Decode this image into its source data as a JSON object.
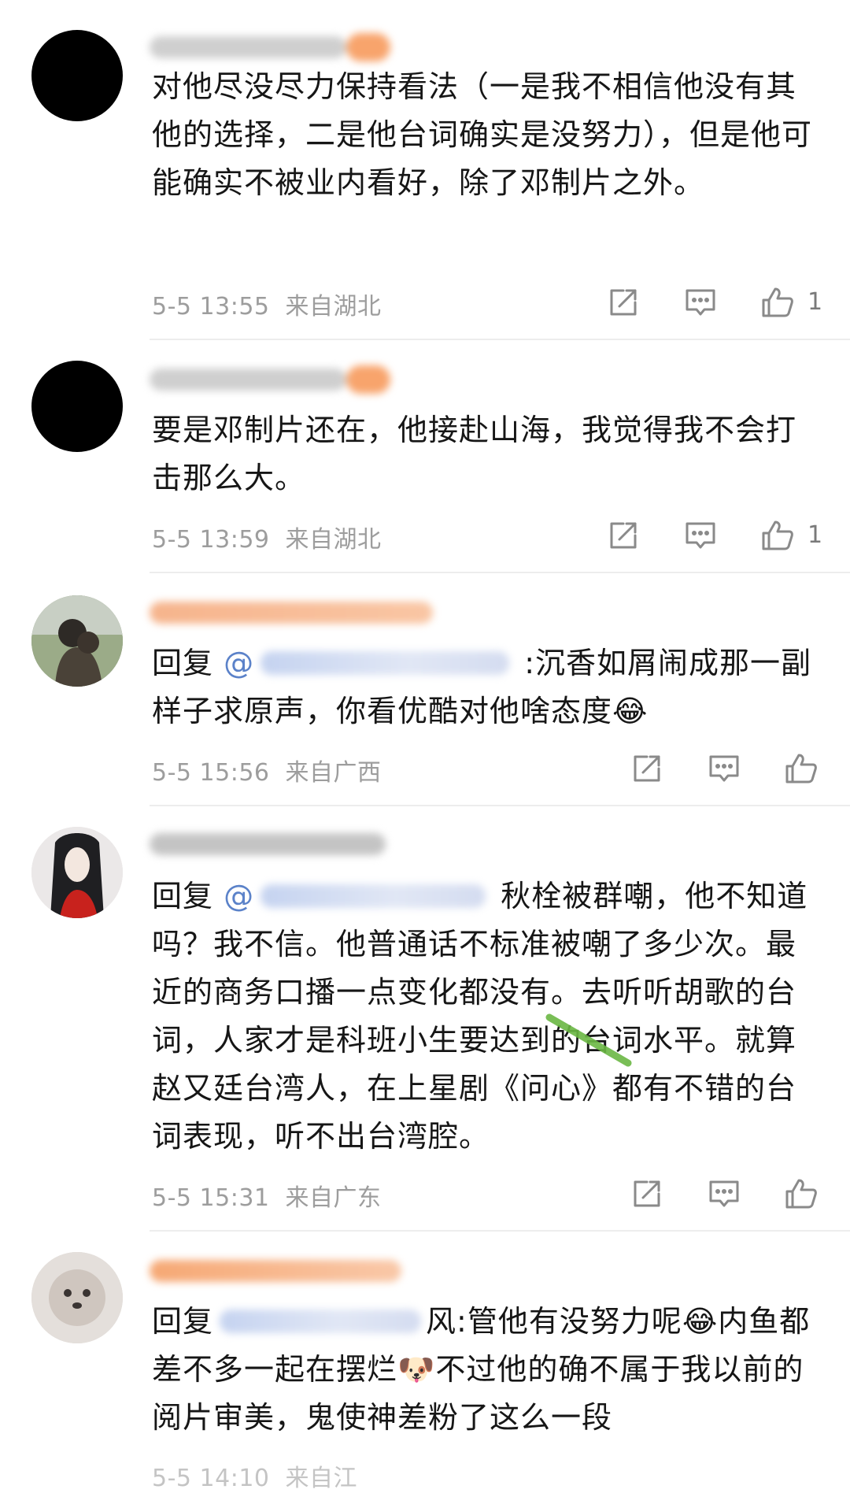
{
  "comments": [
    {
      "text": "对他尽没尽力保持看法（一是我不相信他没有其他的选择，二是他台词确实是没努力），但是他可能确实不被业内看好，除了邓制片之外。",
      "time": "5-5 13:55",
      "location": "来自湖北",
      "likes": "1"
    },
    {
      "text": "要是邓制片还在，他接赴山海，我觉得我不会打击那么大。",
      "time": "5-5 13:59",
      "location": "来自湖北",
      "likes": "1"
    },
    {
      "reply_prefix": "回复",
      "reply_at": "@",
      "text_after": ":沉香如屑闹成那一副样子求原声，你看优酷对他啥态度",
      "emoji": "😂",
      "time": "5-5 15:56",
      "location": "来自广西"
    },
    {
      "reply_prefix": "回复",
      "reply_at": "@",
      "text_after": "秋栓被群嘲，他不知道吗？我不信。他普通话不标准被嘲了多少次。最近的商务口播一点变化都没有。去听听胡歌的台词，人家才是科班小生要达到的台词水平。就算赵又廷台湾人，在上星剧《问心》都有不错的台词表现，听不出台湾腔。",
      "time": "5-5 15:31",
      "location": "来自广东"
    },
    {
      "reply_prefix": "回复",
      "text_a": "风:管他有没努力呢",
      "emoji1": "😂",
      "text_b": "内鱼都差不多一起在摆烂",
      "emoji2": "🐶",
      "text_c": "不过他的确不属于我以前的阅片审美，鬼使神差粉了这么一段",
      "time": "5-5 14:10",
      "location": "来自江"
    }
  ],
  "icons": {
    "share": "share-icon",
    "comment": "comment-icon",
    "like": "thumbs-up-icon"
  },
  "colors": {
    "meta_text": "#9d9d9d",
    "blur_name_orange": "#f7a46a",
    "icon_gray": "#8a8a8a"
  }
}
